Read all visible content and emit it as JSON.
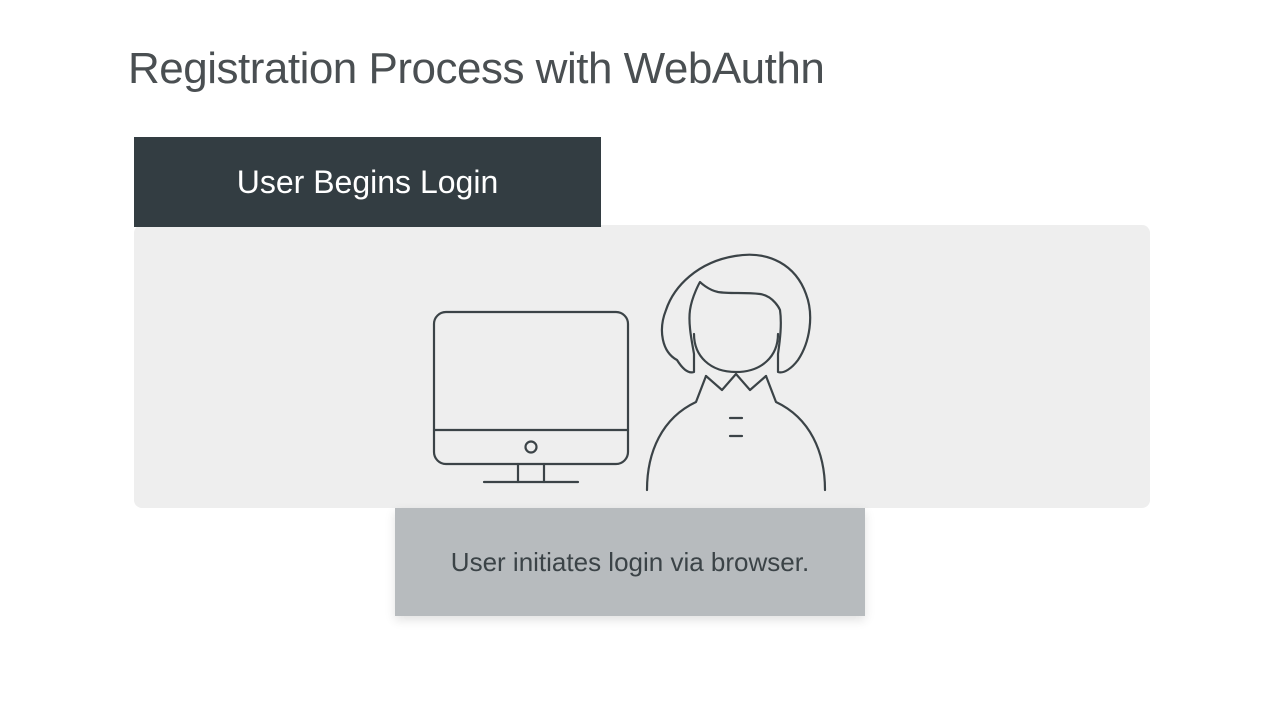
{
  "title": "Registration Process with WebAuthn",
  "banner_label": "User Begins Login",
  "caption": "User initiates login via browser.",
  "colors": {
    "banner_bg": "#333d42",
    "panel_bg": "#eeeeee",
    "caption_bg": "#b7bbbe",
    "text_dark": "#4a4f52",
    "stroke": "#3b4347"
  },
  "icons": {
    "monitor": "monitor-icon",
    "user": "user-icon"
  }
}
